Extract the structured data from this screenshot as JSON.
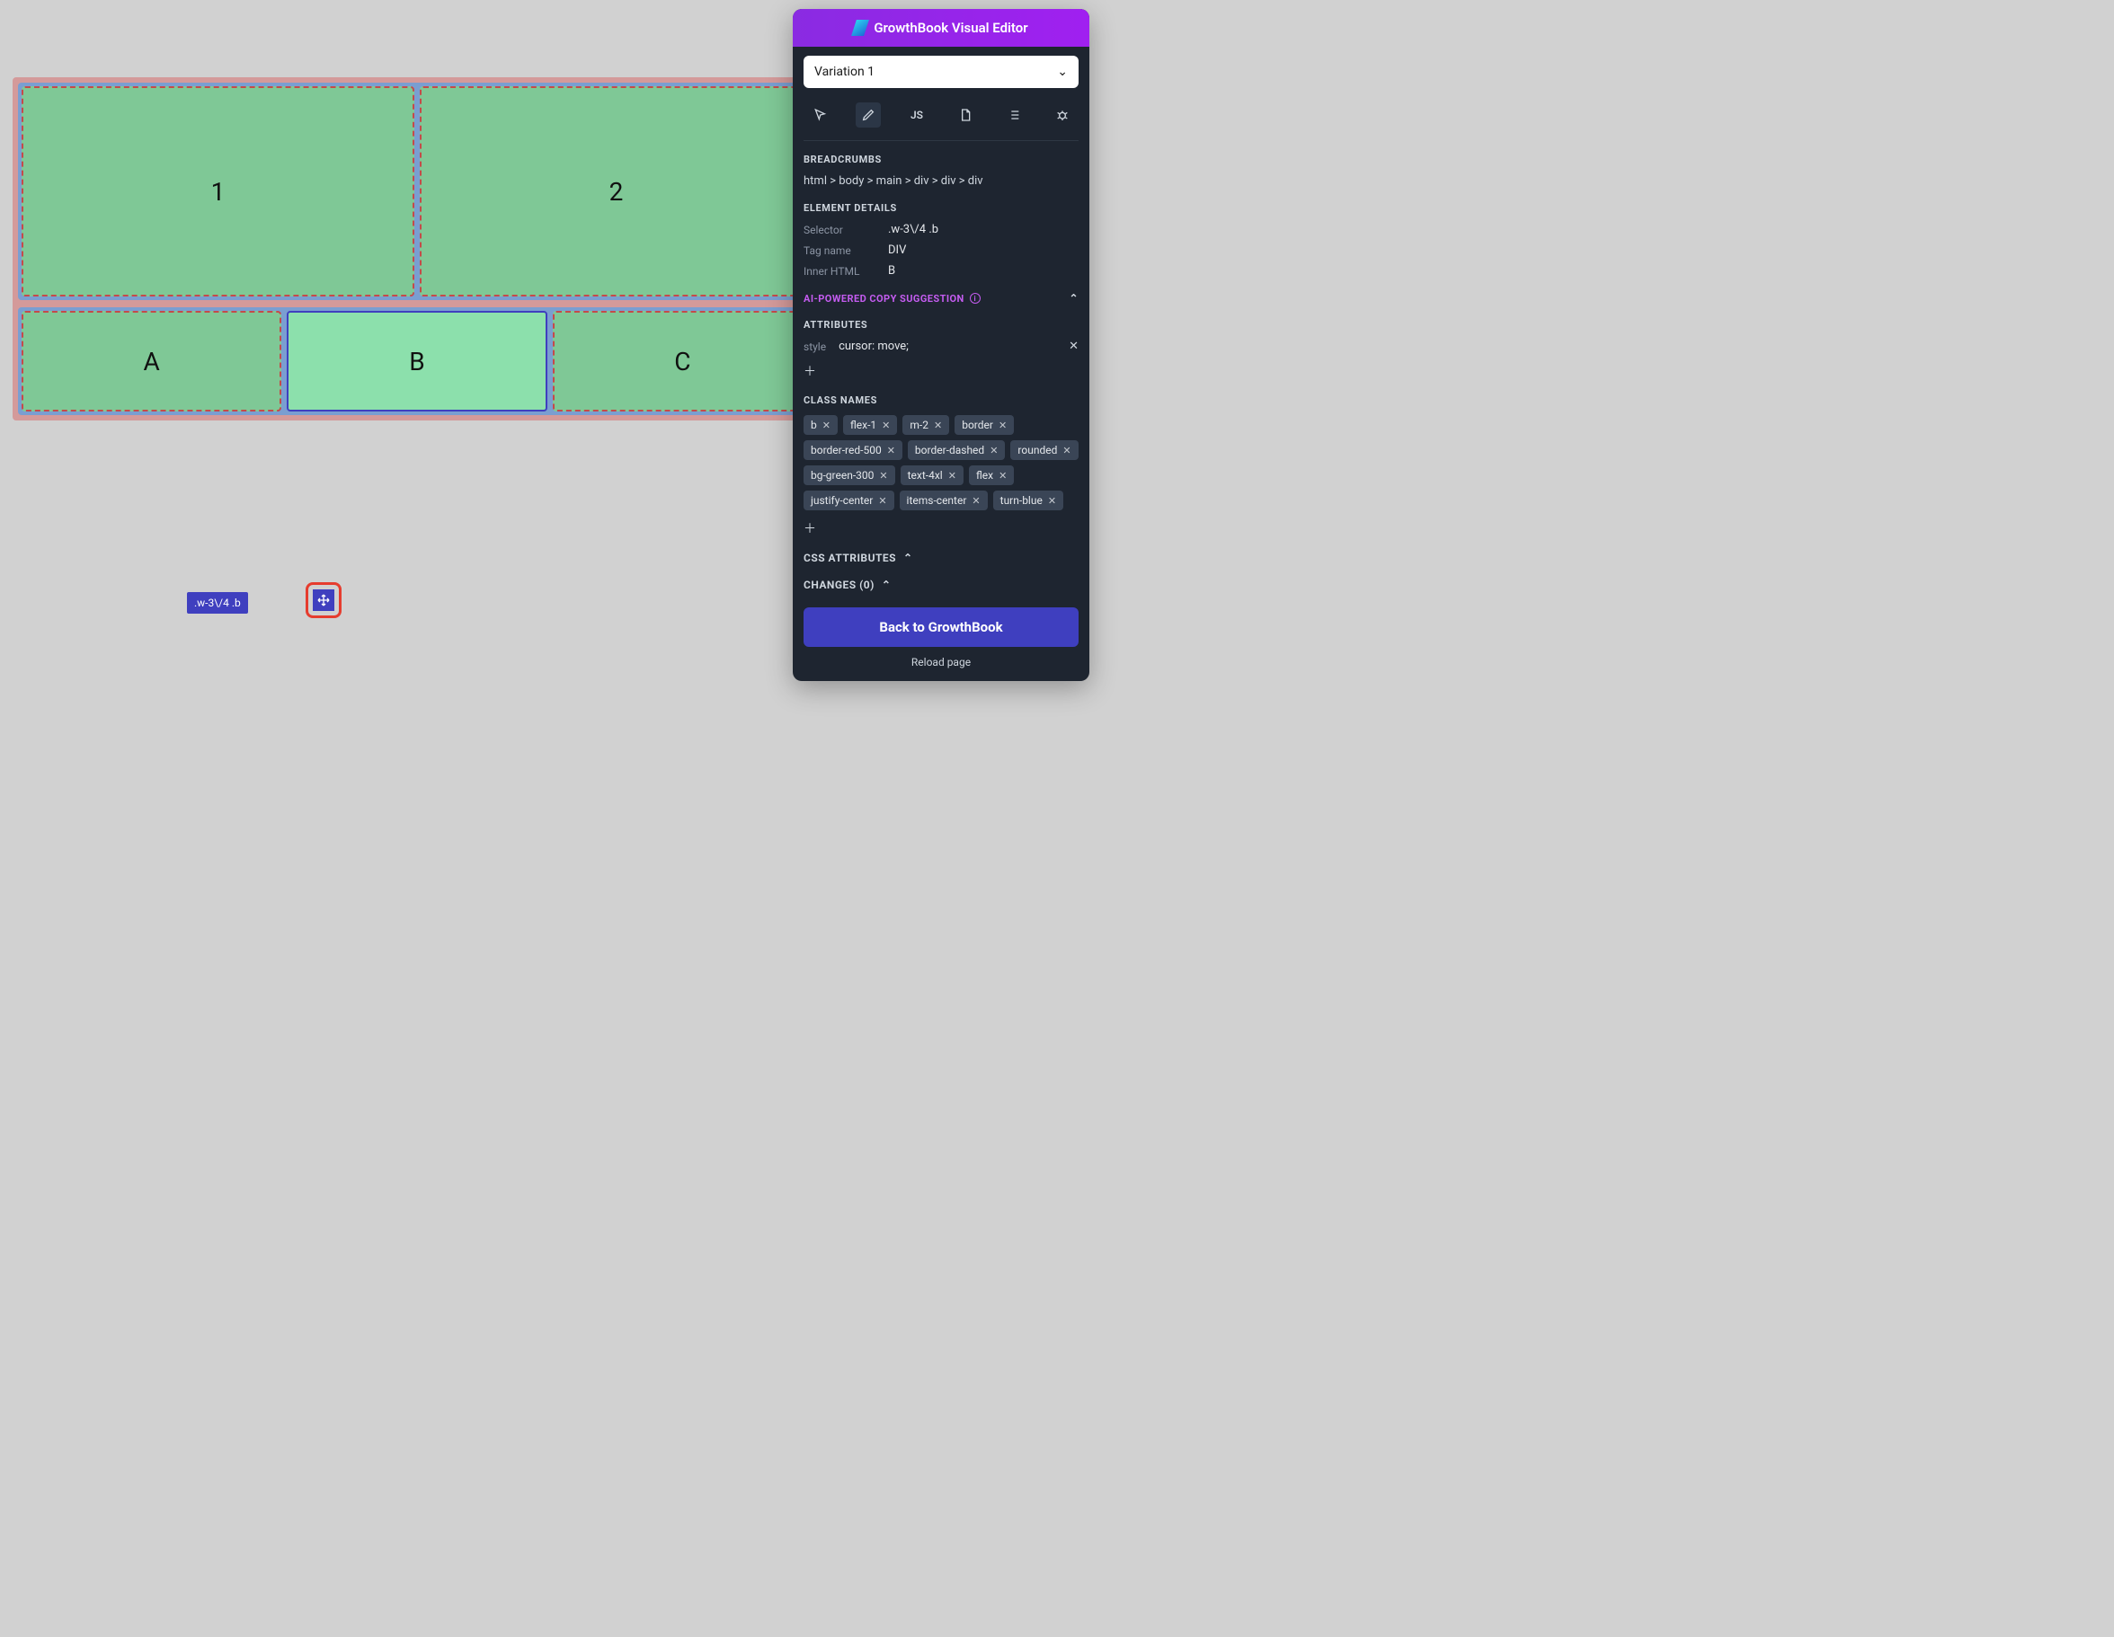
{
  "canvas": {
    "top_row": [
      "1",
      "2"
    ],
    "bottom_row": [
      "A",
      "B",
      "C"
    ],
    "selected_index_bottom": 1,
    "selector_label": ".w-3\\/4 .b"
  },
  "panel": {
    "title": "GrowthBook Visual Editor",
    "variation": "Variation 1",
    "tools": [
      "cursor",
      "pencil",
      "JS",
      "css",
      "list",
      "bug"
    ],
    "active_tool": "pencil",
    "breadcrumbs_label": "BREADCRUMBS",
    "breadcrumbs_path": "html > body > main > div > div > div",
    "element_details_label": "ELEMENT DETAILS",
    "element_details": {
      "Selector": ".w-3\\/4 .b",
      "Tag name": "DIV",
      "Inner HTML": "B"
    },
    "ai_label": "AI-POWERED COPY SUGGESTION",
    "attributes_label": "ATTRIBUTES",
    "attributes": [
      {
        "key": "style",
        "value": "cursor: move;"
      }
    ],
    "class_names_label": "CLASS NAMES",
    "class_names": [
      "b",
      "flex-1",
      "m-2",
      "border",
      "border-red-500",
      "border-dashed",
      "rounded",
      "bg-green-300",
      "text-4xl",
      "flex",
      "justify-center",
      "items-center",
      "turn-blue"
    ],
    "css_attributes_label": "CSS ATTRIBUTES",
    "changes_label": "CHANGES (0)",
    "back_label": "Back to GrowthBook",
    "reload_label": "Reload page"
  }
}
